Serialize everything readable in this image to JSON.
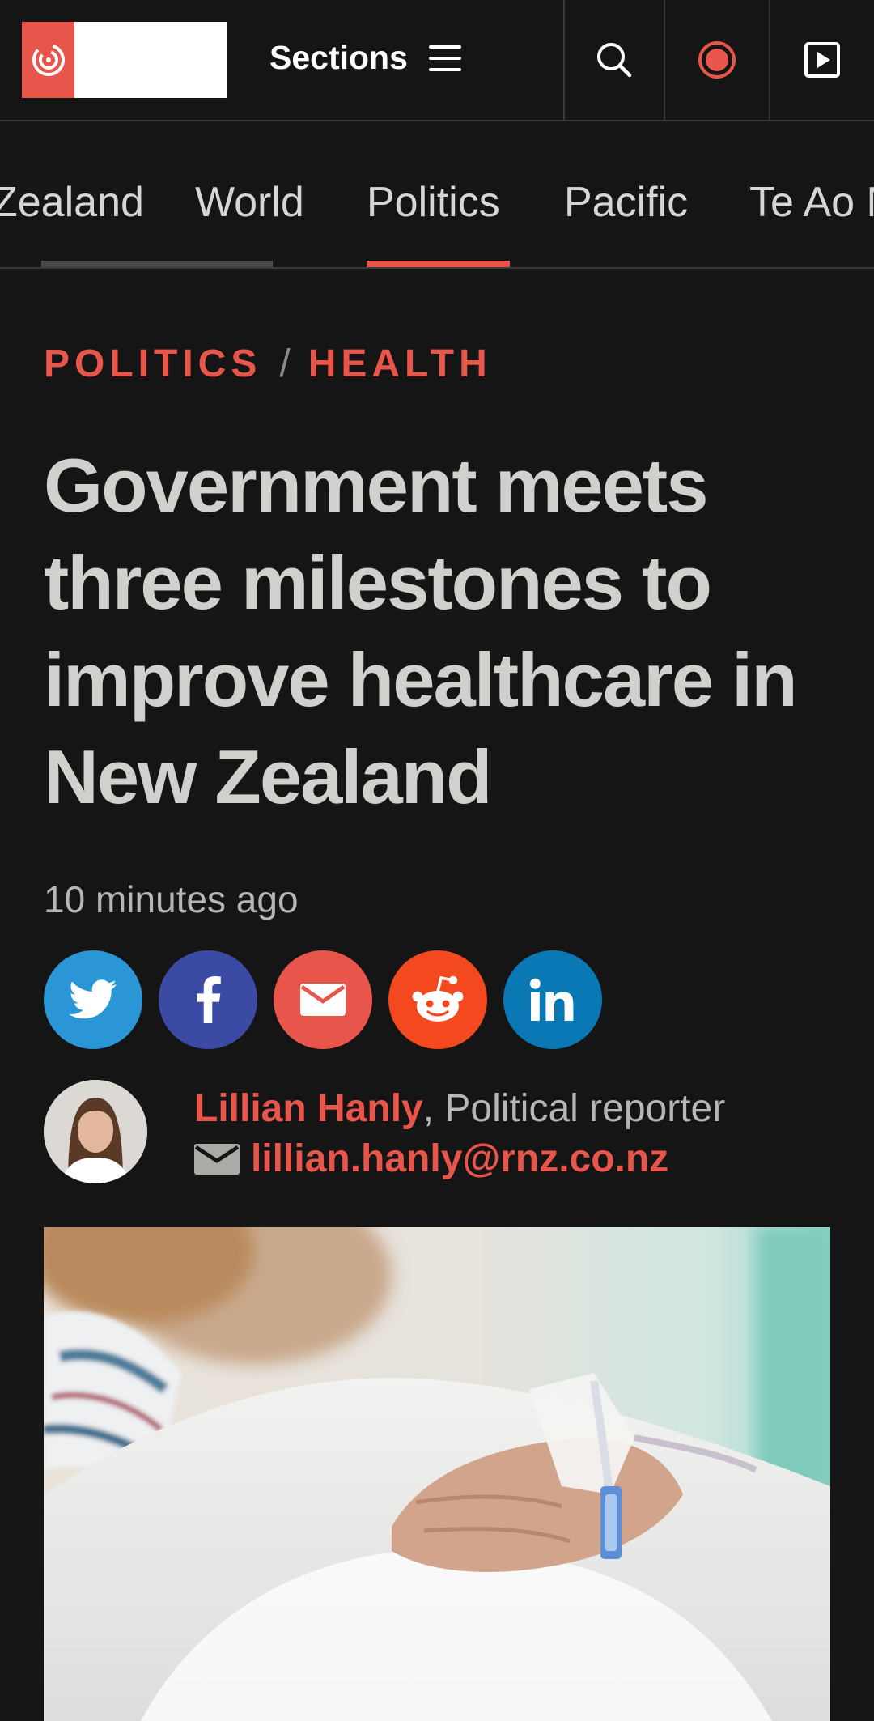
{
  "header": {
    "logo_alt": "RNZ",
    "sections_label": "Sections",
    "icons": [
      "hamburger-icon",
      "search-icon",
      "live-record-icon",
      "play-icon"
    ],
    "accent_color": "#e8554b"
  },
  "nav": {
    "tabs": [
      {
        "label": "Zealand"
      },
      {
        "label": "World"
      },
      {
        "label": "Politics"
      },
      {
        "label": "Pacific"
      },
      {
        "label": "Te Ao M"
      }
    ],
    "active_index": 2
  },
  "article": {
    "kicker_1": "POLITICS",
    "kicker_sep": "/",
    "kicker_2": "HEALTH",
    "headline": "Government meets three milestones to improve healthcare in New Zealand",
    "timestamp": "10 minutes ago",
    "share": [
      {
        "name": "twitter",
        "icon": "twitter-icon",
        "color": "#2b96d6"
      },
      {
        "name": "facebook",
        "icon": "facebook-icon",
        "color": "#3b4aa3"
      },
      {
        "name": "email",
        "icon": "mail-icon",
        "color": "#e8554b"
      },
      {
        "name": "reddit",
        "icon": "reddit-icon",
        "color": "#f4481e"
      },
      {
        "name": "linkedin",
        "icon": "linkedin-icon",
        "color": "#0a78b4"
      }
    ],
    "author": "Lillian Hanly",
    "role": ", Political reporter",
    "email": "lillian.hanly@rnz.co.nz"
  }
}
